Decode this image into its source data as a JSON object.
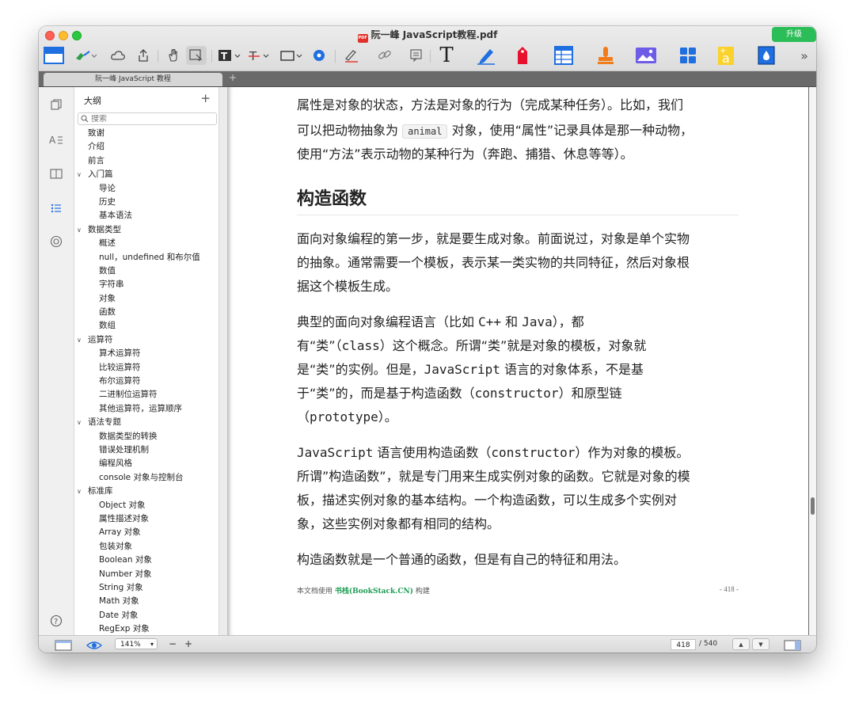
{
  "window": {
    "title": "阮一峰 JavaScript教程.pdf",
    "file_badge": "PDF",
    "upgrade_label": "升级"
  },
  "toolbar": {
    "icons": [
      "sidebar-toggle-icon",
      "highlight-pen-icon",
      "cloud-icon",
      "share-icon",
      "hand-tool-icon",
      "select-tool-icon",
      "text-color-icon",
      "strikethrough-icon",
      "shape-rectangle-icon",
      "eye-review-icon",
      "signature-icon",
      "link-icon",
      "note-icon",
      "text-tool-icon",
      "pen-tool-icon",
      "tag-icon",
      "table-icon",
      "stamp-icon",
      "image-icon",
      "apps-grid-icon",
      "text-box-icon",
      "water-drop-icon",
      "more-icon"
    ],
    "text_tool_glyph": "T",
    "more_glyph": "»"
  },
  "tab": {
    "label": "阮一峰 JavaScript 教程",
    "new_tab": "+"
  },
  "outline": {
    "header": "大纲",
    "add": "+",
    "search_placeholder": "搜索",
    "items": [
      {
        "label": "致谢",
        "level": 0
      },
      {
        "label": "介绍",
        "level": 0
      },
      {
        "label": "前言",
        "level": 0
      },
      {
        "label": "入门篇",
        "level": 0,
        "expanded": true
      },
      {
        "label": "导论",
        "level": 1
      },
      {
        "label": "历史",
        "level": 1
      },
      {
        "label": "基本语法",
        "level": 1
      },
      {
        "label": "数据类型",
        "level": 0,
        "expanded": true
      },
      {
        "label": "概述",
        "level": 1
      },
      {
        "label": "null，undefined 和布尔值",
        "level": 1
      },
      {
        "label": "数值",
        "level": 1
      },
      {
        "label": "字符串",
        "level": 1
      },
      {
        "label": "对象",
        "level": 1
      },
      {
        "label": "函数",
        "level": 1
      },
      {
        "label": "数组",
        "level": 1
      },
      {
        "label": "运算符",
        "level": 0,
        "expanded": true
      },
      {
        "label": "算术运算符",
        "level": 1
      },
      {
        "label": "比较运算符",
        "level": 1
      },
      {
        "label": "布尔运算符",
        "level": 1
      },
      {
        "label": "二进制位运算符",
        "level": 1
      },
      {
        "label": "其他运算符，运算顺序",
        "level": 1
      },
      {
        "label": "语法专题",
        "level": 0,
        "expanded": true
      },
      {
        "label": "数据类型的转换",
        "level": 1
      },
      {
        "label": "错误处理机制",
        "level": 1
      },
      {
        "label": "编程风格",
        "level": 1
      },
      {
        "label": "console 对象与控制台",
        "level": 1
      },
      {
        "label": "标准库",
        "level": 0,
        "expanded": true
      },
      {
        "label": "Object 对象",
        "level": 1
      },
      {
        "label": "属性描述对象",
        "level": 1
      },
      {
        "label": "Array 对象",
        "level": 1
      },
      {
        "label": "包装对象",
        "level": 1
      },
      {
        "label": "Boolean 对象",
        "level": 1
      },
      {
        "label": "Number 对象",
        "level": 1
      },
      {
        "label": "String 对象",
        "level": 1
      },
      {
        "label": "Math 对象",
        "level": 1
      },
      {
        "label": "Date 对象",
        "level": 1
      },
      {
        "label": "RegExp 对象",
        "level": 1
      }
    ]
  },
  "document": {
    "para1_line1": "属性是对象的状态，方法是对象的行为（完成某种任务）。比如，我们",
    "para1_line2_pre": "可以把动物抽象为",
    "para1_code": "animal",
    "para1_line2_post": "对象，使用“属性”记录具体是那一种动物，",
    "para1_line3": "使用“方法”表示动物的某种行为（奔跑、捕猎、休息等等）。",
    "heading": "构造函数",
    "para2_line1": "面向对象编程的第一步，就是要生成对象。前面说过，对象是单个实物",
    "para2_line2": "的抽象。通常需要一个模板，表示某一类实物的共同特征，然后对象根",
    "para2_line3": "据这个模板生成。",
    "para3_line1_a": "典型的面向对象编程语言（比如 ",
    "para3_line1_b": "C++",
    "para3_line1_c": " 和 ",
    "para3_line1_d": "Java",
    "para3_line1_e": "），都",
    "para3_line2_a": "有“类”（",
    "para3_line2_b": "class",
    "para3_line2_c": "）这个概念。所谓“类”就是对象的模板，对象就",
    "para3_line3_a": "是“类”的实例。但是，",
    "para3_line3_b": "JavaScript",
    "para3_line3_c": " 语言的对象体系，不是基",
    "para3_line4_a": "于“类”的，而是基于构造函数（",
    "para3_line4_b": "constructor",
    "para3_line4_c": "）和原型链",
    "para3_line5_a": "（",
    "para3_line5_b": "prototype",
    "para3_line5_c": "）。",
    "para4_line1_a": "JavaScript",
    "para4_line1_b": " 语言使用构造函数（",
    "para4_line1_c": "constructor",
    "para4_line1_d": "）作为对象的模板。",
    "para4_line2": "所谓”构造函数”，就是专门用来生成实例对象的函数。它就是对象的模",
    "para4_line3": "板，描述实例对象的基本结构。一个构造函数，可以生成多个实例对",
    "para4_line4": "象，这些实例对象都有相同的结构。",
    "para5": "构造函数就是一个普通的函数，但是有自己的特征和用法。",
    "footer_pre": "本文档使用 ",
    "footer_brand": "书栈(BookStack.CN)",
    "footer_post": " 构建",
    "page_label": "- 418 -"
  },
  "statusbar": {
    "zoom": "141%",
    "zoom_out": "−",
    "zoom_in": "+",
    "current_page": "418",
    "total_pages": "/ 540",
    "prev": "▲",
    "next": "▼"
  },
  "colors": {
    "accent_blue": "#1f6fe0",
    "upgrade_green": "#2bbd57",
    "brand_green": "#1f9d55"
  }
}
